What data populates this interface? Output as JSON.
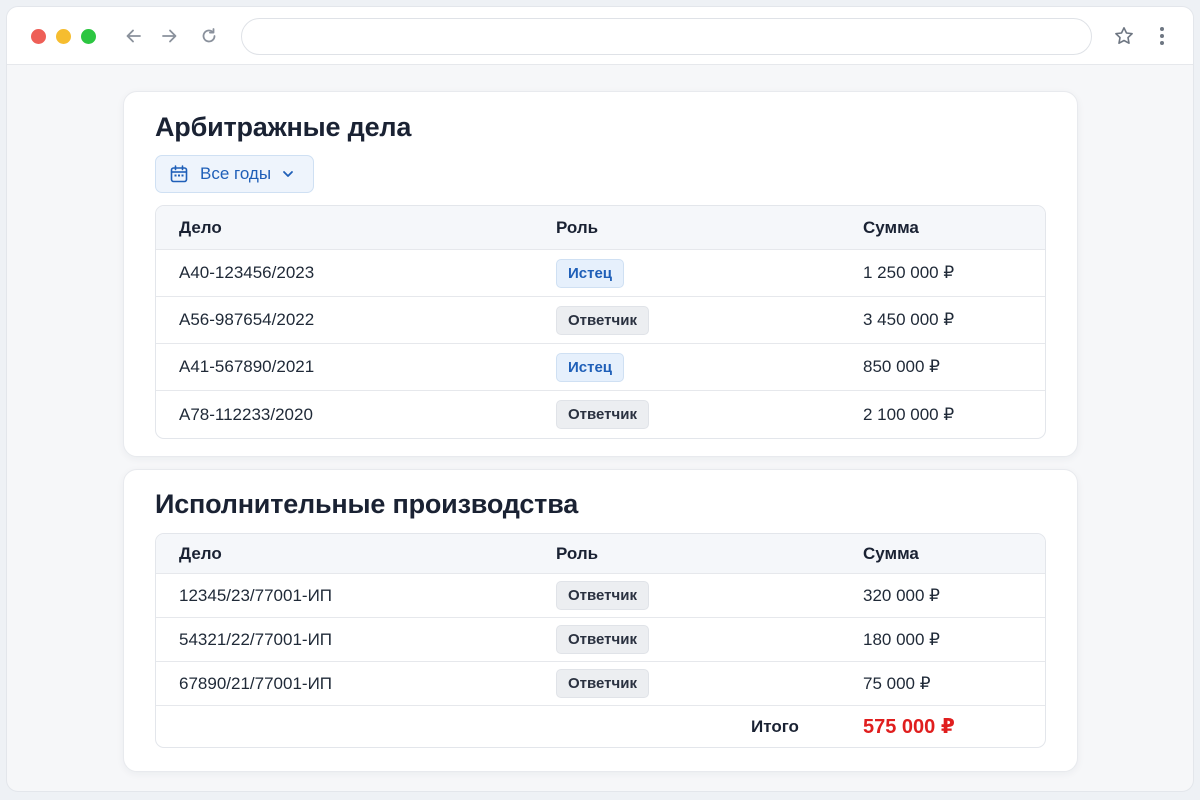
{
  "browser": {
    "url": ""
  },
  "arbitration": {
    "title": "Арбитражные дела",
    "filter": {
      "label": "Все годы",
      "icon": "calendar-icon"
    },
    "columns": {
      "case": "Дело",
      "role": "Роль",
      "sum": "Сумма"
    },
    "rows": [
      {
        "case": "А40-123456/2023",
        "role": "Истец",
        "role_type": "plaintiff",
        "sum": "1 250 000 ₽"
      },
      {
        "case": "А56-987654/2022",
        "role": "Ответчик",
        "role_type": "defendant",
        "sum": "3 450 000 ₽"
      },
      {
        "case": "А41-567890/2021",
        "role": "Истец",
        "role_type": "plaintiff",
        "sum": "850 000 ₽"
      },
      {
        "case": "А78-112233/2020",
        "role": "Ответчик",
        "role_type": "defendant",
        "sum": "2 100 000 ₽"
      }
    ]
  },
  "enforcement": {
    "title": "Исполнительные производства",
    "columns": {
      "case": "Дело",
      "role": "Роль",
      "sum": "Сумма"
    },
    "rows": [
      {
        "case": "12345/23/77001-ИП",
        "role": "Ответчик",
        "role_type": "defendant",
        "sum": "320 000 ₽"
      },
      {
        "case": "54321/22/77001-ИП",
        "role": "Ответчик",
        "role_type": "defendant",
        "sum": "180 000 ₽"
      },
      {
        "case": "67890/21/77001-ИП",
        "role": "Ответчик",
        "role_type": "defendant",
        "sum": "75 000 ₽"
      }
    ],
    "total": {
      "label": "Итого",
      "value": "575 000 ₽"
    }
  },
  "colors": {
    "accent": "#1f5fb8",
    "total_red": "#e01e1e"
  }
}
